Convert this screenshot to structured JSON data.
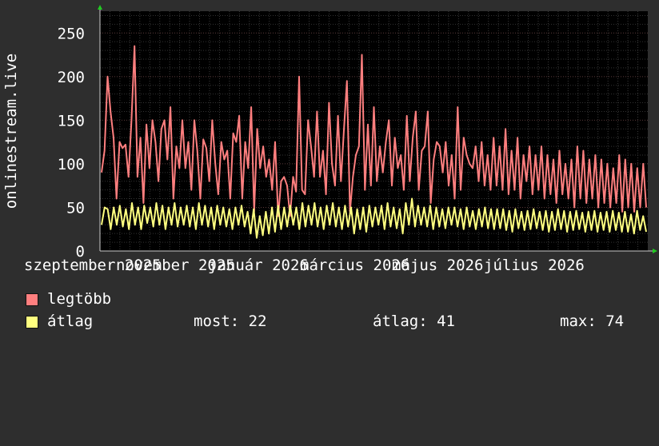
{
  "chart_data": {
    "type": "line",
    "ylabel": "onlinestream.live",
    "ylim": [
      0,
      275
    ],
    "yticks": [
      0,
      50,
      100,
      150,
      200,
      250
    ],
    "grid": true,
    "x_tick_labels": [
      "szeptember 2025",
      "november 2025",
      "január 2026",
      "március 2026",
      "május 2026",
      "július 2026"
    ],
    "series": [
      {
        "name": "legtöbb",
        "color": "#ff7f7f",
        "values": [
          90,
          115,
          200,
          160,
          130,
          60,
          125,
          118,
          122,
          85,
          150,
          235,
          85,
          130,
          55,
          145,
          95,
          150,
          125,
          80,
          140,
          150,
          105,
          165,
          60,
          120,
          95,
          150,
          95,
          125,
          70,
          150,
          115,
          60,
          128,
          118,
          80,
          150,
          100,
          65,
          125,
          105,
          115,
          60,
          135,
          125,
          155,
          60,
          125,
          95,
          165,
          45,
          140,
          95,
          120,
          85,
          105,
          70,
          125,
          40,
          80,
          85,
          75,
          40,
          85,
          68,
          200,
          70,
          65,
          150,
          120,
          85,
          160,
          85,
          115,
          65,
          170,
          100,
          75,
          155,
          80,
          140,
          195,
          45,
          85,
          110,
          120,
          225,
          70,
          145,
          75,
          165,
          80,
          120,
          90,
          125,
          150,
          75,
          130,
          95,
          110,
          70,
          155,
          80,
          130,
          160,
          70,
          115,
          120,
          160,
          55,
          105,
          125,
          120,
          90,
          125,
          75,
          110,
          60,
          165,
          70,
          130,
          110,
          100,
          95,
          120,
          80,
          125,
          75,
          110,
          70,
          130,
          75,
          120,
          70,
          140,
          65,
          115,
          70,
          130,
          60,
          110,
          80,
          120,
          65,
          110,
          70,
          120,
          60,
          110,
          65,
          105,
          55,
          115,
          65,
          100,
          60,
          105,
          50,
          120,
          60,
          115,
          55,
          105,
          60,
          110,
          50,
          105,
          55,
          100,
          50,
          95,
          55,
          110,
          45,
          105,
          50,
          100,
          45,
          95,
          50,
          100,
          50
        ]
      },
      {
        "name": "átlag",
        "color": "#ffff80",
        "values": [
          30,
          50,
          48,
          25,
          50,
          30,
          52,
          28,
          48,
          25,
          55,
          30,
          50,
          25,
          52,
          32,
          50,
          28,
          55,
          30,
          52,
          25,
          50,
          30,
          55,
          28,
          50,
          30,
          52,
          28,
          50,
          25,
          55,
          30,
          52,
          28,
          50,
          25,
          52,
          30,
          50,
          28,
          48,
          25,
          50,
          30,
          52,
          28,
          45,
          20,
          48,
          15,
          40,
          18,
          45,
          20,
          50,
          22,
          52,
          25,
          50,
          28,
          52,
          30,
          50,
          25,
          55,
          28,
          52,
          30,
          55,
          28,
          50,
          25,
          52,
          30,
          55,
          28,
          50,
          25,
          52,
          28,
          50,
          20,
          48,
          25,
          50,
          22,
          52,
          28,
          50,
          30,
          52,
          25,
          55,
          28,
          50,
          26,
          48,
          20,
          55,
          30,
          60,
          28,
          52,
          30,
          50,
          28,
          52,
          25,
          50,
          28,
          48,
          26,
          50,
          30,
          50,
          28,
          48,
          25,
          50,
          28,
          46,
          25,
          48,
          28,
          50,
          26,
          48,
          25,
          48,
          26,
          48,
          24,
          46,
          22,
          48,
          26,
          45,
          24,
          46,
          25,
          48,
          26,
          45,
          24,
          46,
          22,
          45,
          24,
          48,
          25,
          46,
          22,
          45,
          24,
          46,
          25,
          44,
          22,
          45,
          24,
          46,
          22,
          44,
          24,
          45,
          22,
          46,
          24,
          44,
          22,
          45,
          22,
          42,
          20,
          46,
          24,
          40,
          22
        ]
      }
    ]
  },
  "legend": {
    "series1_label": "legtöbb",
    "series2_label": "átlag",
    "now_label": "most:",
    "now_value": "22",
    "avg_label": "átlag:",
    "avg_value": "41",
    "max_label": "max:",
    "max_value": "74"
  }
}
